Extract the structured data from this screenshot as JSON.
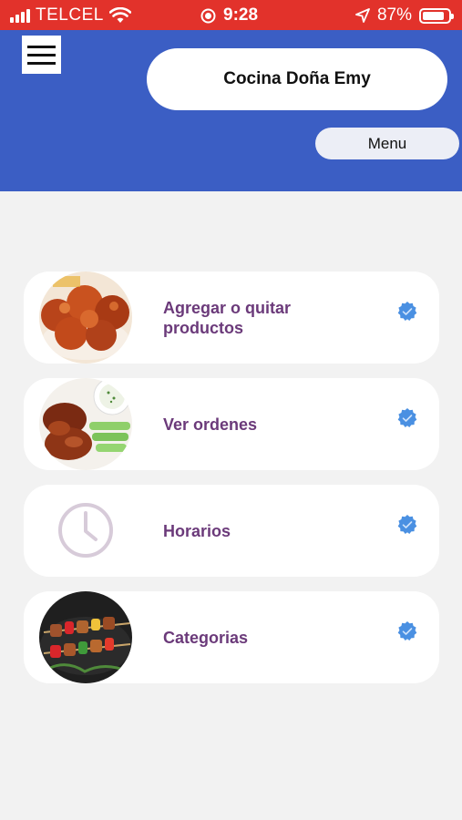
{
  "status_bar": {
    "carrier": "TELCEL",
    "time": "9:28",
    "battery": "87%",
    "battery_level": 0.87
  },
  "header": {
    "title": "Cocina Doña Emy",
    "menu_label": "Menu"
  },
  "menu_items": [
    {
      "label_line1": "Agregar o quitar",
      "label_line2": "productos",
      "icon": "chicken-wings-photo"
    },
    {
      "label": "Ver ordenes",
      "icon": "bbq-chicken-photo"
    },
    {
      "label": "Horarios",
      "icon": "clock-icon"
    },
    {
      "label": "Categorias",
      "icon": "skewers-photo"
    }
  ],
  "colors": {
    "status_bar": "#e2322b",
    "header": "#3b5ec4",
    "label": "#6b3a7a",
    "check": "#4a90e2"
  }
}
